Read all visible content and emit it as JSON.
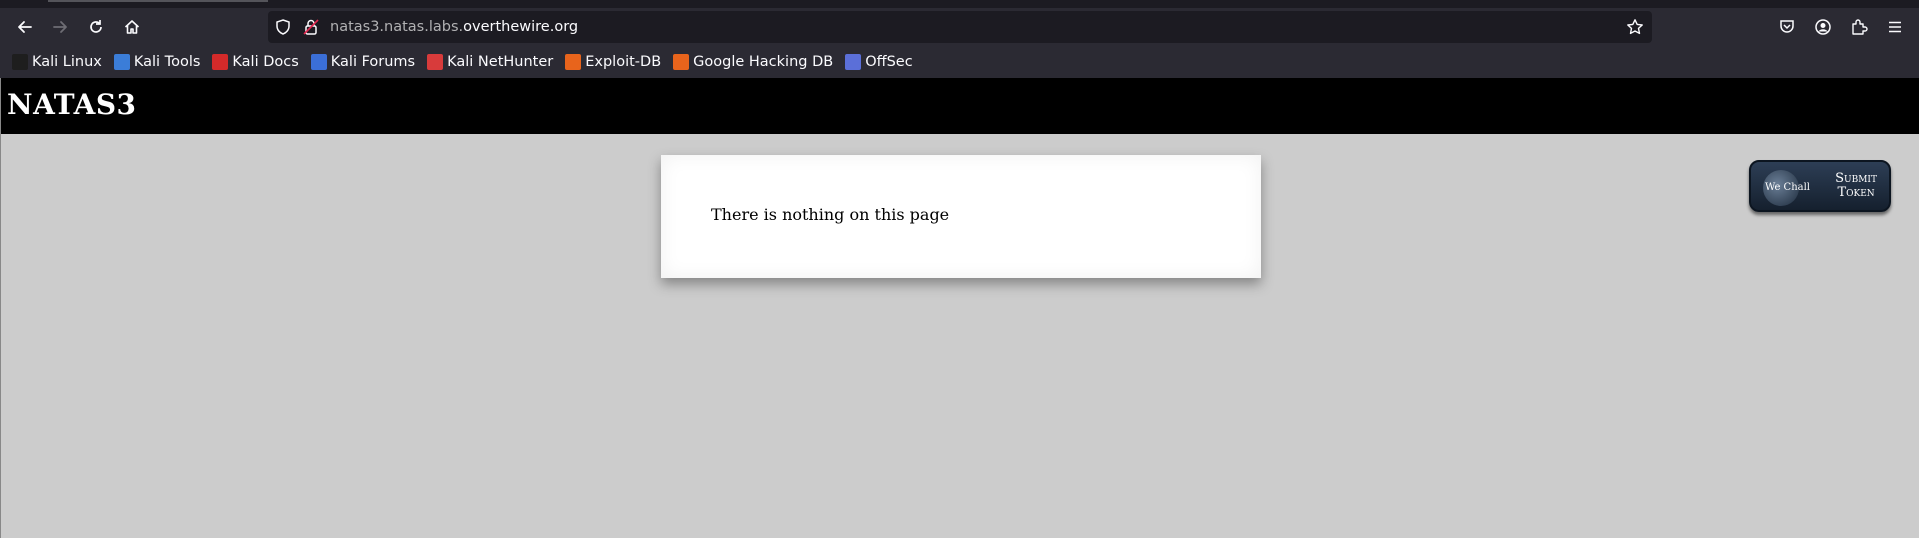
{
  "browser": {
    "url_prefix": "natas3.natas.labs.",
    "url_domain": "overthewire.org"
  },
  "bookmarks": [
    {
      "label": "Kali Linux",
      "color": "#1e1e1e"
    },
    {
      "label": "Kali Tools",
      "color": "#3b7dd8"
    },
    {
      "label": "Kali Docs",
      "color": "#d42a2a"
    },
    {
      "label": "Kali Forums",
      "color": "#3b6fd8"
    },
    {
      "label": "Kali NetHunter",
      "color": "#d83b3b"
    },
    {
      "label": "Exploit-DB",
      "color": "#e8641c"
    },
    {
      "label": "Google Hacking DB",
      "color": "#e8641c"
    },
    {
      "label": "OffSec",
      "color": "#5b6fd8"
    }
  ],
  "page": {
    "title": "NATAS3",
    "message": "There is nothing on this page"
  },
  "wechall": {
    "brand": "We Chall",
    "submit_line1": "Submit",
    "submit_line2": "Token"
  }
}
